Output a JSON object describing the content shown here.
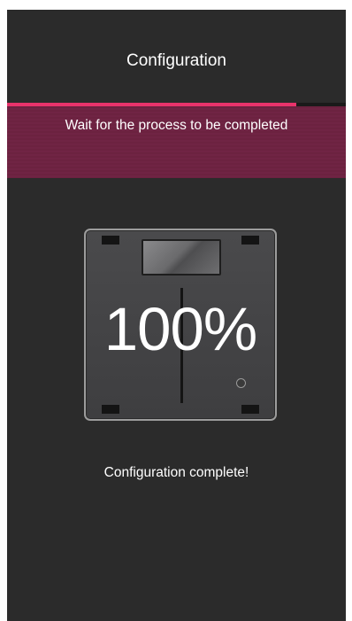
{
  "header": {
    "title": "Configuration"
  },
  "progress": {
    "fraction": 0.855,
    "fill_color": "#e8336b"
  },
  "banner": {
    "text": "Wait for the process to be completed"
  },
  "device": {
    "icon": "wall-switch-icon",
    "percent_label": "100%"
  },
  "status": {
    "text": "Configuration complete!"
  }
}
